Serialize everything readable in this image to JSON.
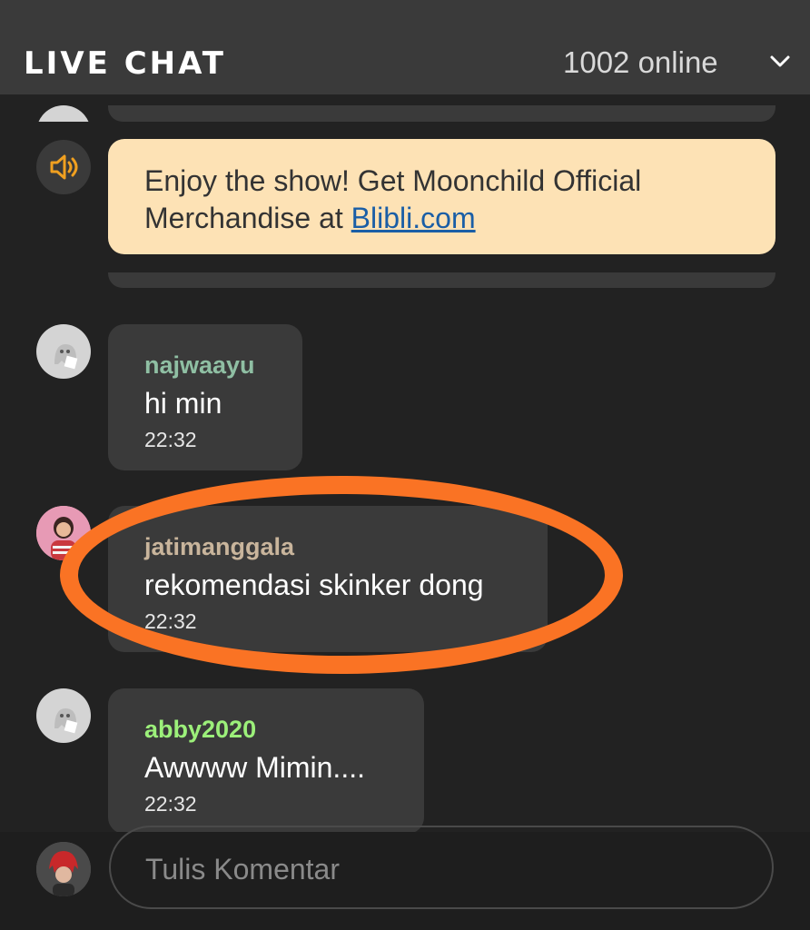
{
  "header": {
    "title": "LIVE CHAT",
    "online": "1002 online"
  },
  "announcement": {
    "text": "Enjoy the show! Get Moonchild Official Merchandise at ",
    "link": "Blibli.com"
  },
  "messages": [
    {
      "user": "najwaayu",
      "text": "hi min",
      "time": "22:32",
      "user_color": "#8fbfa3"
    },
    {
      "user": "jatimanggala",
      "text": "rekomendasi skinker dong",
      "time": "22:32",
      "user_color": "#c9b59c"
    },
    {
      "user": "abby2020",
      "text": "Awwww Mimin....",
      "time": "22:32",
      "user_color": "#9cf07a"
    }
  ],
  "composer": {
    "placeholder": "Tulis Komentar"
  },
  "colors": {
    "highlight": "#fa7324",
    "announce_bg": "#fde2b5",
    "speaker": "#f0a020"
  }
}
